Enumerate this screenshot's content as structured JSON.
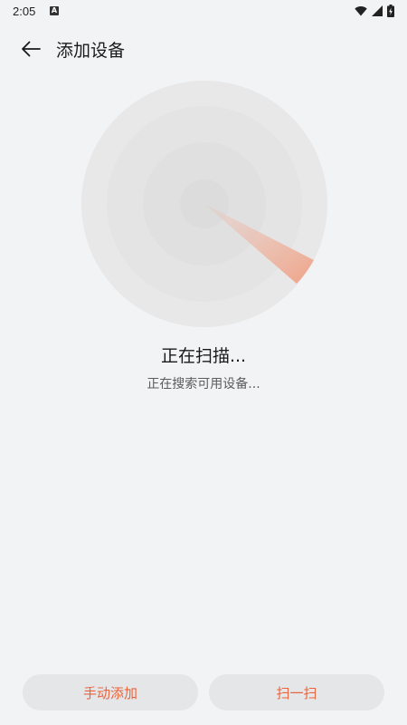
{
  "status_bar": {
    "time": "2:05",
    "notification_letter": "A"
  },
  "header": {
    "title": "添加设备"
  },
  "scan": {
    "heading": "正在扫描...",
    "subtext": "正在搜索可用设备..."
  },
  "actions": {
    "manual_add_label": "手动添加",
    "scan_code_label": "扫一扫"
  },
  "colors": {
    "accent": "#e8643c",
    "background": "#f2f3f5",
    "button_bg": "#e5e6e8"
  },
  "icons": {
    "back": "arrow-left-icon",
    "wifi": "wifi-icon",
    "signal": "signal-icon",
    "battery": "battery-icon"
  }
}
